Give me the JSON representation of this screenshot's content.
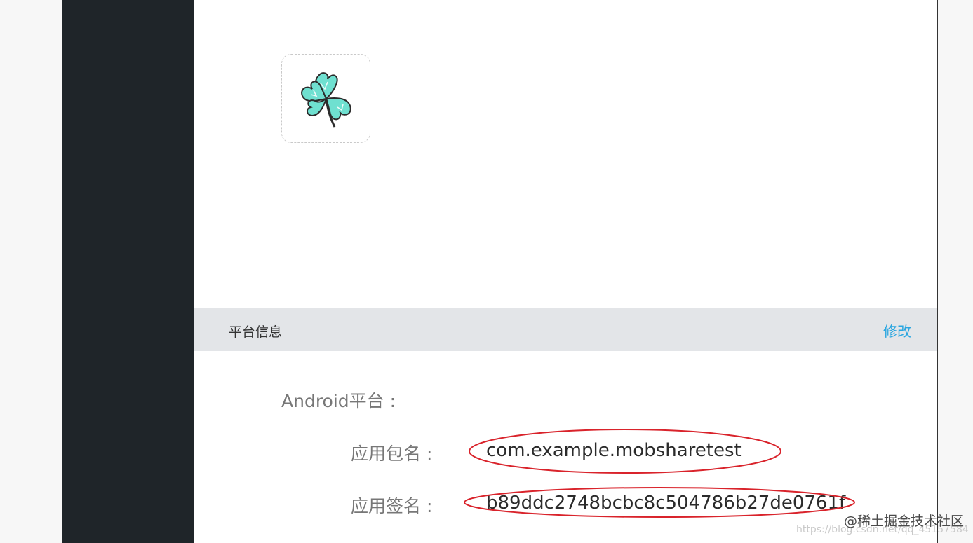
{
  "section": {
    "title": "平台信息",
    "edit_label": "修改"
  },
  "platform": {
    "label": "Android平台 :",
    "fields": [
      {
        "label": "应用包名 :",
        "value": "com.example.mobsharetest"
      },
      {
        "label": "应用签名 :",
        "value": "b89ddc2748bcbc8c504786b27de0761f"
      }
    ]
  },
  "watermark": {
    "site": "@稀土掘金技术社区",
    "url": "https://blog.csdn.net/qq_45157584"
  },
  "colors": {
    "sidebar": "#1f2529",
    "header_bg": "#e3e5e8",
    "link": "#2aa6e0",
    "annotation": "#d9232b",
    "icon_mint": "#6fe0d0"
  },
  "icons": {
    "app_icon": "clover-icon"
  }
}
